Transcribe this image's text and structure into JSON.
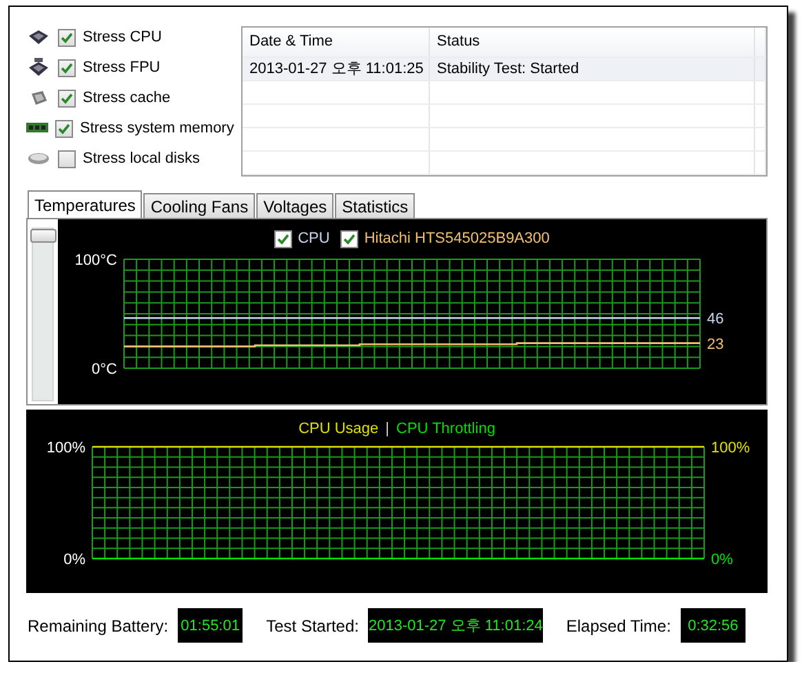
{
  "stress_options": [
    {
      "label": "Stress CPU",
      "checked": true,
      "kind": "cpu"
    },
    {
      "label": "Stress FPU",
      "checked": true,
      "kind": "fpu"
    },
    {
      "label": "Stress cache",
      "checked": true,
      "kind": "cache"
    },
    {
      "label": "Stress system memory",
      "checked": true,
      "kind": "memory"
    },
    {
      "label": "Stress local disks",
      "checked": false,
      "kind": "disk"
    }
  ],
  "log": {
    "columns": [
      "Date & Time",
      "Status"
    ],
    "rows": [
      [
        "2013-01-27 오후 11:01:25",
        "Stability Test: Started"
      ]
    ]
  },
  "tabs": [
    {
      "label": "Temperatures",
      "selected": true
    },
    {
      "label": "Cooling Fans",
      "selected": false
    },
    {
      "label": "Voltages",
      "selected": false
    },
    {
      "label": "Statistics",
      "selected": false
    }
  ],
  "zoom_slider": {
    "level": 1
  },
  "temperature_chart": {
    "legend": [
      {
        "checked": true
      },
      {
        "checked": true
      }
    ],
    "chart_data": {
      "type": "line",
      "grid": true,
      "ylim": [
        0,
        100
      ],
      "yticks": [
        {
          "value": 0,
          "label": "0°C"
        },
        {
          "value": 100,
          "label": "100°C"
        }
      ],
      "series": [
        {
          "name": "CPU",
          "color": "#c8d8f0",
          "values": [
            46,
            46,
            46,
            46,
            46,
            46,
            46,
            46,
            46,
            46,
            46,
            46,
            46,
            46,
            46,
            46,
            46,
            46,
            46,
            46,
            46,
            46,
            46
          ]
        },
        {
          "name": "Hitachi HTS545025B9A300",
          "color": "#f0c070",
          "values": [
            20,
            20,
            20,
            20,
            20,
            21,
            21,
            21,
            21,
            22,
            22,
            22,
            22,
            22,
            22,
            23,
            23,
            23,
            23,
            23,
            23,
            23,
            23
          ]
        }
      ],
      "annotations": [
        "46",
        "23"
      ]
    }
  },
  "usage_chart": {
    "separator": "|",
    "chart_data": {
      "type": "line",
      "grid": true,
      "ylim": [
        0,
        100
      ],
      "yticks": [
        {
          "value": 0,
          "label": "0%"
        },
        {
          "value": 100,
          "label": "100%"
        }
      ],
      "series": [
        {
          "name": "CPU Usage",
          "color": "#e0e000",
          "values": [
            100,
            100,
            100,
            100,
            100,
            100,
            100,
            100,
            100,
            100,
            100,
            100,
            100,
            100,
            100,
            100,
            100,
            100,
            100,
            100,
            100,
            100,
            100
          ]
        },
        {
          "name": "CPU Throttling",
          "color": "#00e000",
          "values": [
            0,
            0,
            0,
            0,
            0,
            0,
            0,
            0,
            0,
            0,
            0,
            0,
            0,
            0,
            0,
            0,
            0,
            0,
            0,
            0,
            0,
            0,
            0
          ]
        }
      ],
      "annotations": [
        "100%",
        "0%"
      ]
    }
  },
  "status_bar": [
    {
      "label": "Remaining Battery:",
      "value": "01:55:01"
    },
    {
      "label": "Test Started:",
      "value": "2013-01-27 오후 11:01:24"
    },
    {
      "label": "Elapsed Time:",
      "value": "0:32:56"
    }
  ]
}
